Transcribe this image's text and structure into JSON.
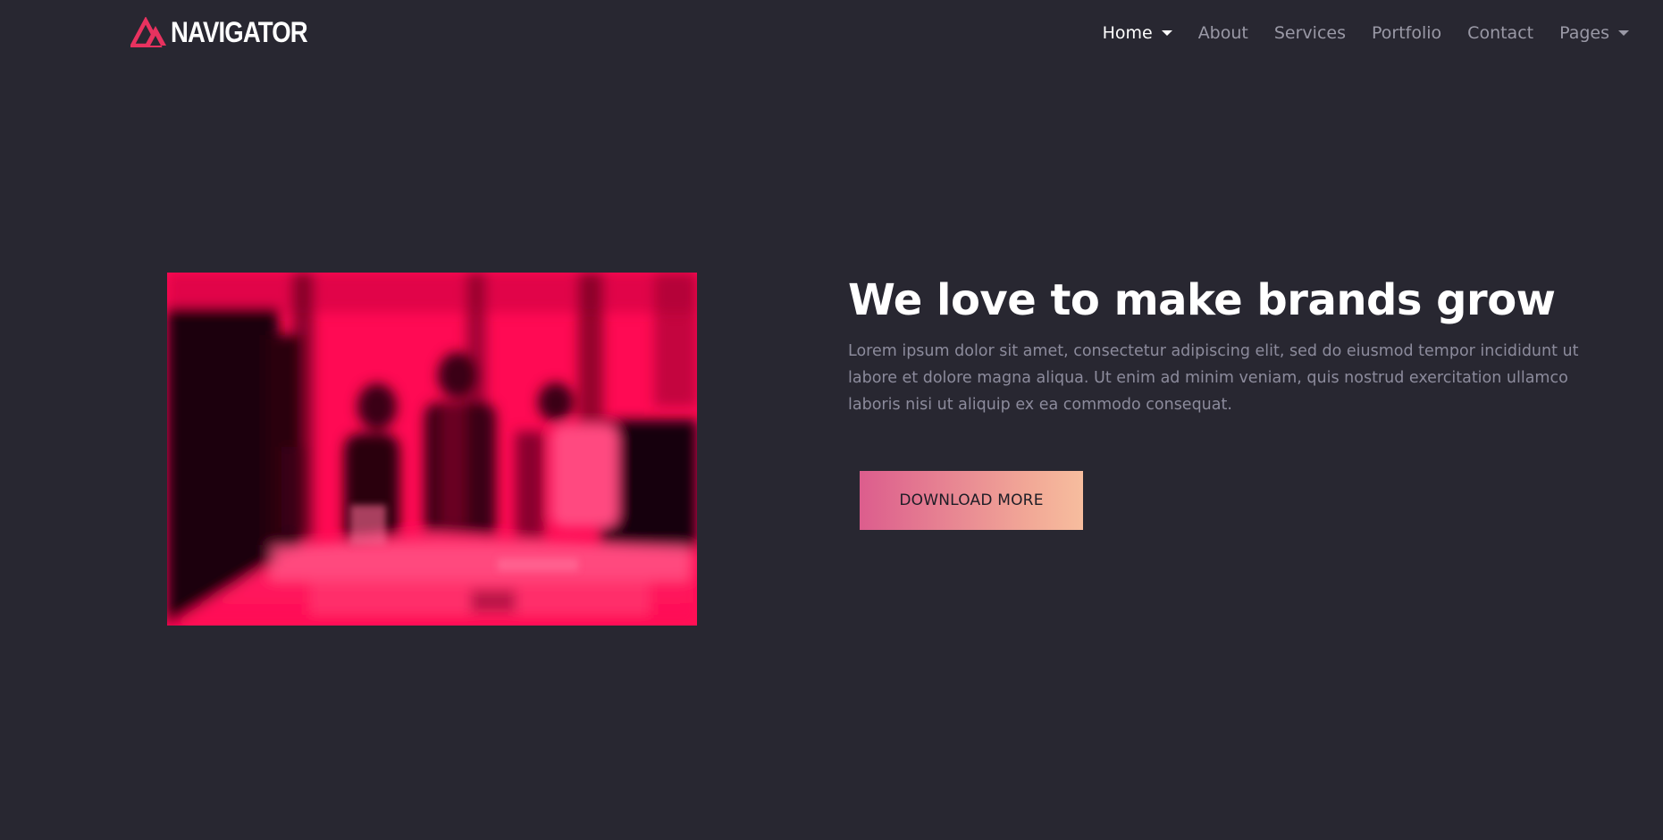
{
  "brand": {
    "name": "NAVIGATOR",
    "logo_icon": "triangle-mountain-logo",
    "accent": "#e8325f"
  },
  "nav": {
    "items": [
      {
        "label": "Home",
        "active": true,
        "dropdown": true
      },
      {
        "label": "About"
      },
      {
        "label": "Services"
      },
      {
        "label": "Portfolio"
      },
      {
        "label": "Contact"
      },
      {
        "label": "Pages",
        "dropdown": true
      }
    ]
  },
  "hero": {
    "title": "We love to make brands grow",
    "description": "Lorem ipsum dolor sit amet, consectetur adipiscing elit, sed do eiusmod tempor incididunt ut labore et dolore magna aliqua. Ut enim ad minim veniam, quis nostrud exercitation ullamco laboris nisi ut aliquip ex ea commodo consequat.",
    "button_label": "DOWNLOAD MORE",
    "image_icon": "team-office-photo"
  },
  "colors": {
    "background": "#282731",
    "photo_tint": "#ff0a54",
    "button_gradient_start": "#dc5d8d",
    "button_gradient_end": "#f7bd9e"
  }
}
